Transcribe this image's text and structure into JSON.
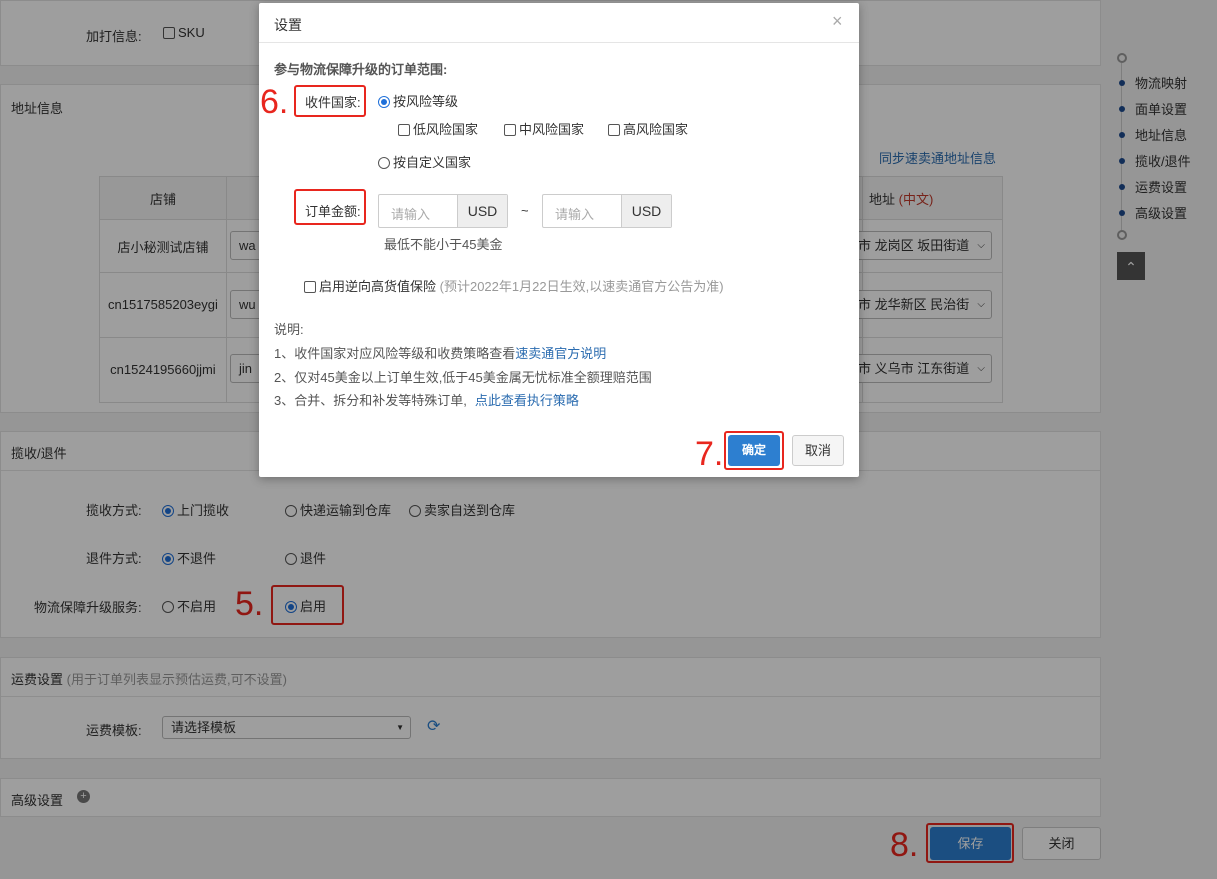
{
  "print_info": {
    "label": "加打信息:",
    "sku": "SKU"
  },
  "address": {
    "title": "地址信息",
    "sync_link": "同步速卖通地址信息",
    "table": {
      "col_store": "店铺",
      "col_addr": "地址",
      "col_addr_note": "(中文)",
      "rows": [
        {
          "store": "店小秘测试店铺",
          "input": "wa",
          "addr": "市 龙岗区 坂田街道"
        },
        {
          "store": "cn1517585203eygi",
          "input": "wu",
          "addr": "市 龙华新区 民治街"
        },
        {
          "store": "cn1524195660jjmi",
          "input": "jin",
          "addr": "市 义乌市 江东街道"
        }
      ]
    }
  },
  "pickup": {
    "title": "揽收/退件",
    "method_label": "揽收方式:",
    "methods": [
      "上门揽收",
      "快递运输到仓库",
      "卖家自送到仓库"
    ],
    "return_label": "退件方式:",
    "returns": [
      "不退件",
      "退件"
    ],
    "upgrade_label": "物流保障升级服务:",
    "upgrade_options": [
      "不启用",
      "启用"
    ]
  },
  "shipping": {
    "title": "运费设置",
    "note": "(用于订单列表显示预估运费,可不设置)",
    "template_label": "运费模板:",
    "template_value": "请选择模板"
  },
  "advanced": {
    "title": "高级设置"
  },
  "footer": {
    "save": "保存",
    "close": "关闭"
  },
  "side_nav": [
    "物流映射",
    "面单设置",
    "地址信息",
    "揽收/退件",
    "运费设置",
    "高级设置"
  ],
  "modal": {
    "title": "设置",
    "close": "×",
    "scope_title": "参与物流保障升级的订单范围:",
    "country_label": "收件国家:",
    "by_risk": "按风险等级",
    "risk_levels": [
      "低风险国家",
      "中风险国家",
      "高风险国家"
    ],
    "by_custom": "按自定义国家",
    "amount_label": "订单金额:",
    "amount_placeholder": "请输入",
    "currency": "USD",
    "tilde": "~",
    "amount_hint": "最低不能小于45美金",
    "insurance_label": "启用逆向高货值保险",
    "insurance_note": "(预计2022年1月22日生效,以速卖通官方公告为准)",
    "notes_title": "说明:",
    "note1_prefix": "1、收件国家对应风险等级和收费策略查看",
    "note1_link": "速卖通官方说明",
    "note2": "2、仅对45美金以上订单生效,低于45美金属无忧标准全额理赔范围",
    "note3_prefix": "3、合并、拆分和补发等特殊订单,",
    "note3_link": "点此查看执行策略",
    "confirm": "确定",
    "cancel": "取消"
  },
  "annotations": [
    "5.",
    "6.",
    "7.",
    "8."
  ],
  "colors": {
    "accent": "#1e6fd9",
    "annotation": "#e8261e",
    "primary_button": "#2d7fd0"
  }
}
